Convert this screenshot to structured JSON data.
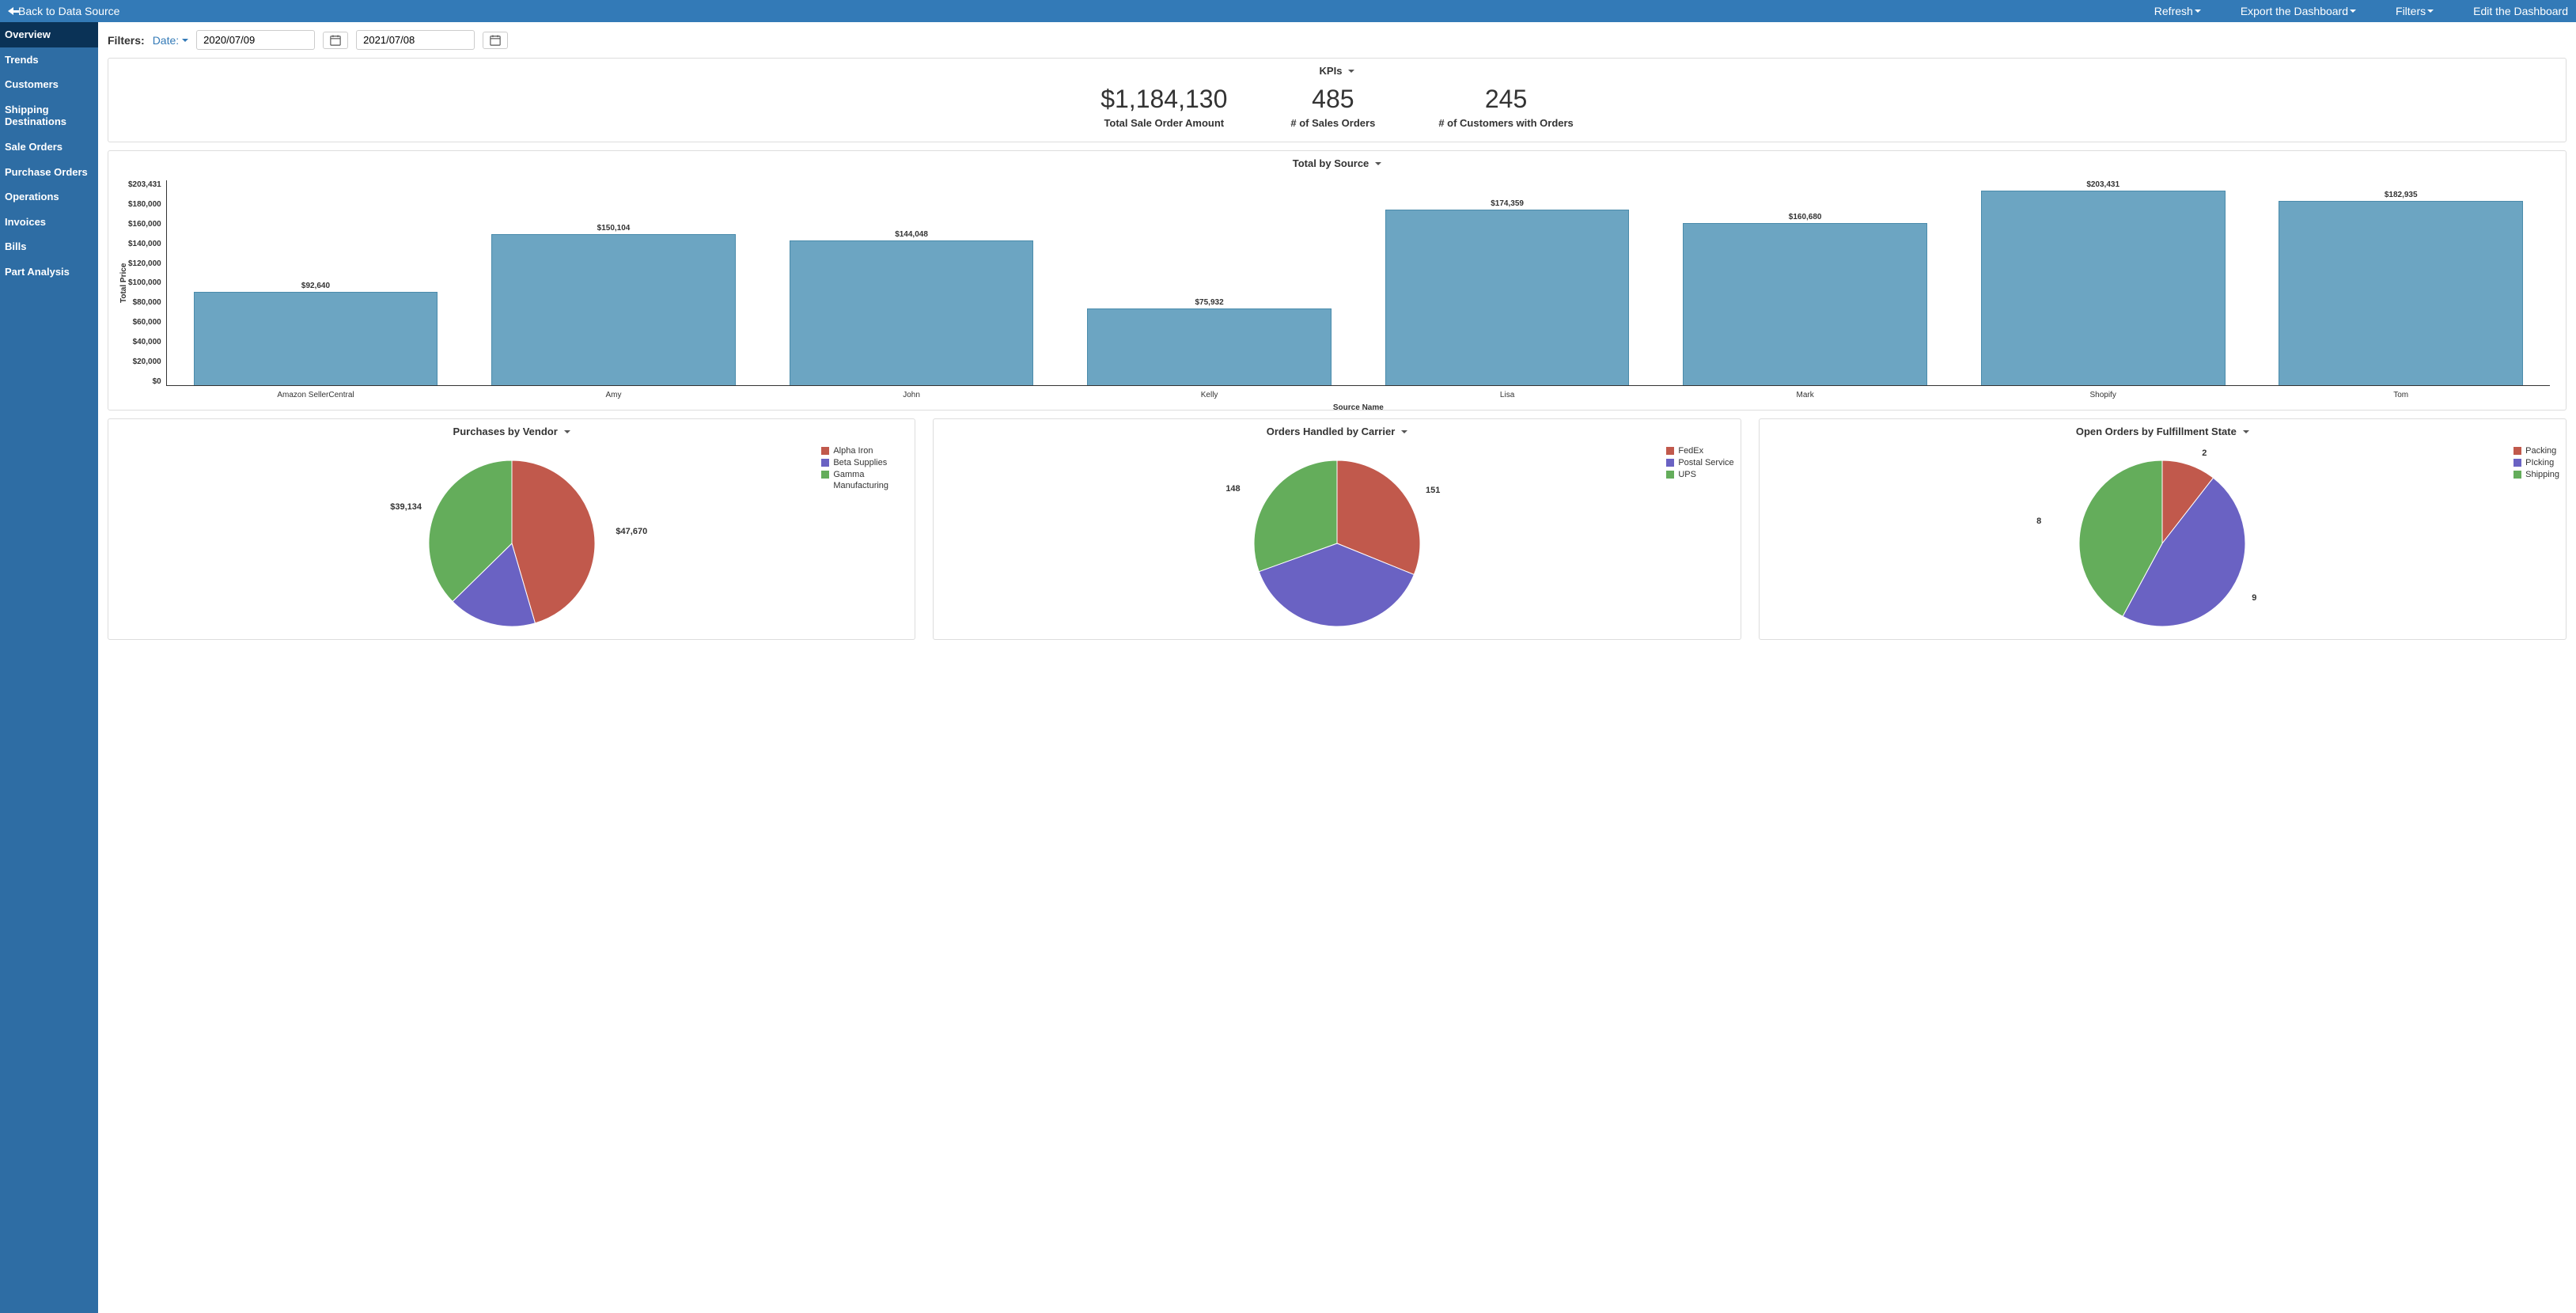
{
  "topbar": {
    "back_label": "Back to Data Source",
    "refresh": "Refresh",
    "export": "Export the Dashboard",
    "filters": "Filters",
    "edit": "Edit the Dashboard"
  },
  "sidebar": {
    "items": [
      {
        "label": "Overview",
        "active": true
      },
      {
        "label": "Trends"
      },
      {
        "label": "Customers"
      },
      {
        "label": "Shipping Destinations"
      },
      {
        "label": "Sale Orders"
      },
      {
        "label": "Purchase Orders"
      },
      {
        "label": "Operations"
      },
      {
        "label": "Invoices"
      },
      {
        "label": "Bills"
      },
      {
        "label": "Part Analysis"
      }
    ]
  },
  "filters": {
    "label": "Filters:",
    "date_link": "Date:",
    "date_from": "2020/07/09",
    "date_to": "2021/07/08"
  },
  "kpis_panel": {
    "title": "KPIs",
    "items": [
      {
        "value": "$1,184,130",
        "label": "Total Sale Order Amount"
      },
      {
        "value": "485",
        "label": "# of Sales Orders"
      },
      {
        "value": "245",
        "label": "# of Customers with Orders"
      }
    ]
  },
  "chart_data": [
    {
      "type": "bar",
      "title": "Total by Source",
      "xlabel": "Source Name",
      "ylabel": "Total Price",
      "ylim": [
        0,
        203431
      ],
      "y_ticks": [
        "$203,431",
        "$180,000",
        "$160,000",
        "$140,000",
        "$120,000",
        "$100,000",
        "$80,000",
        "$60,000",
        "$40,000",
        "$20,000",
        "$0"
      ],
      "categories": [
        "Amazon SellerCentral",
        "Amy",
        "John",
        "Kelly",
        "Lisa",
        "Mark",
        "Shopify",
        "Tom"
      ],
      "values": [
        92640,
        150104,
        144048,
        75932,
        174359,
        160680,
        203431,
        182935
      ],
      "value_labels": [
        "$92,640",
        "$150,104",
        "$144,048",
        "$75,932",
        "$174,359",
        "$160,680",
        "$203,431",
        "$182,935"
      ]
    },
    {
      "type": "pie",
      "title": "Purchases by Vendor",
      "series": [
        {
          "name": "Alpha Iron",
          "value": 47670,
          "label": "$47,670",
          "color": "#c1594c"
        },
        {
          "name": "Beta Supplies",
          "value": 18000,
          "color": "#6a62c3"
        },
        {
          "name": "Gamma Manufacturing",
          "value": 39134,
          "label": "$39,134",
          "color": "#64ad5b"
        }
      ]
    },
    {
      "type": "pie",
      "title": "Orders Handled by Carrier",
      "series": [
        {
          "name": "FedEx",
          "value": 151,
          "label": "151",
          "color": "#c1594c"
        },
        {
          "name": "Postal Service",
          "value": 186,
          "color": "#6a62c3"
        },
        {
          "name": "UPS",
          "value": 148,
          "label": "148",
          "color": "#64ad5b"
        }
      ]
    },
    {
      "type": "pie",
      "title": "Open Orders by Fulfillment State",
      "series": [
        {
          "name": "Packing",
          "value": 2,
          "label": "2",
          "color": "#c1594c"
        },
        {
          "name": "PIcking",
          "value": 9,
          "label": "9",
          "color": "#6a62c3"
        },
        {
          "name": "Shipping",
          "value": 8,
          "label": "8",
          "color": "#64ad5b"
        }
      ]
    }
  ]
}
